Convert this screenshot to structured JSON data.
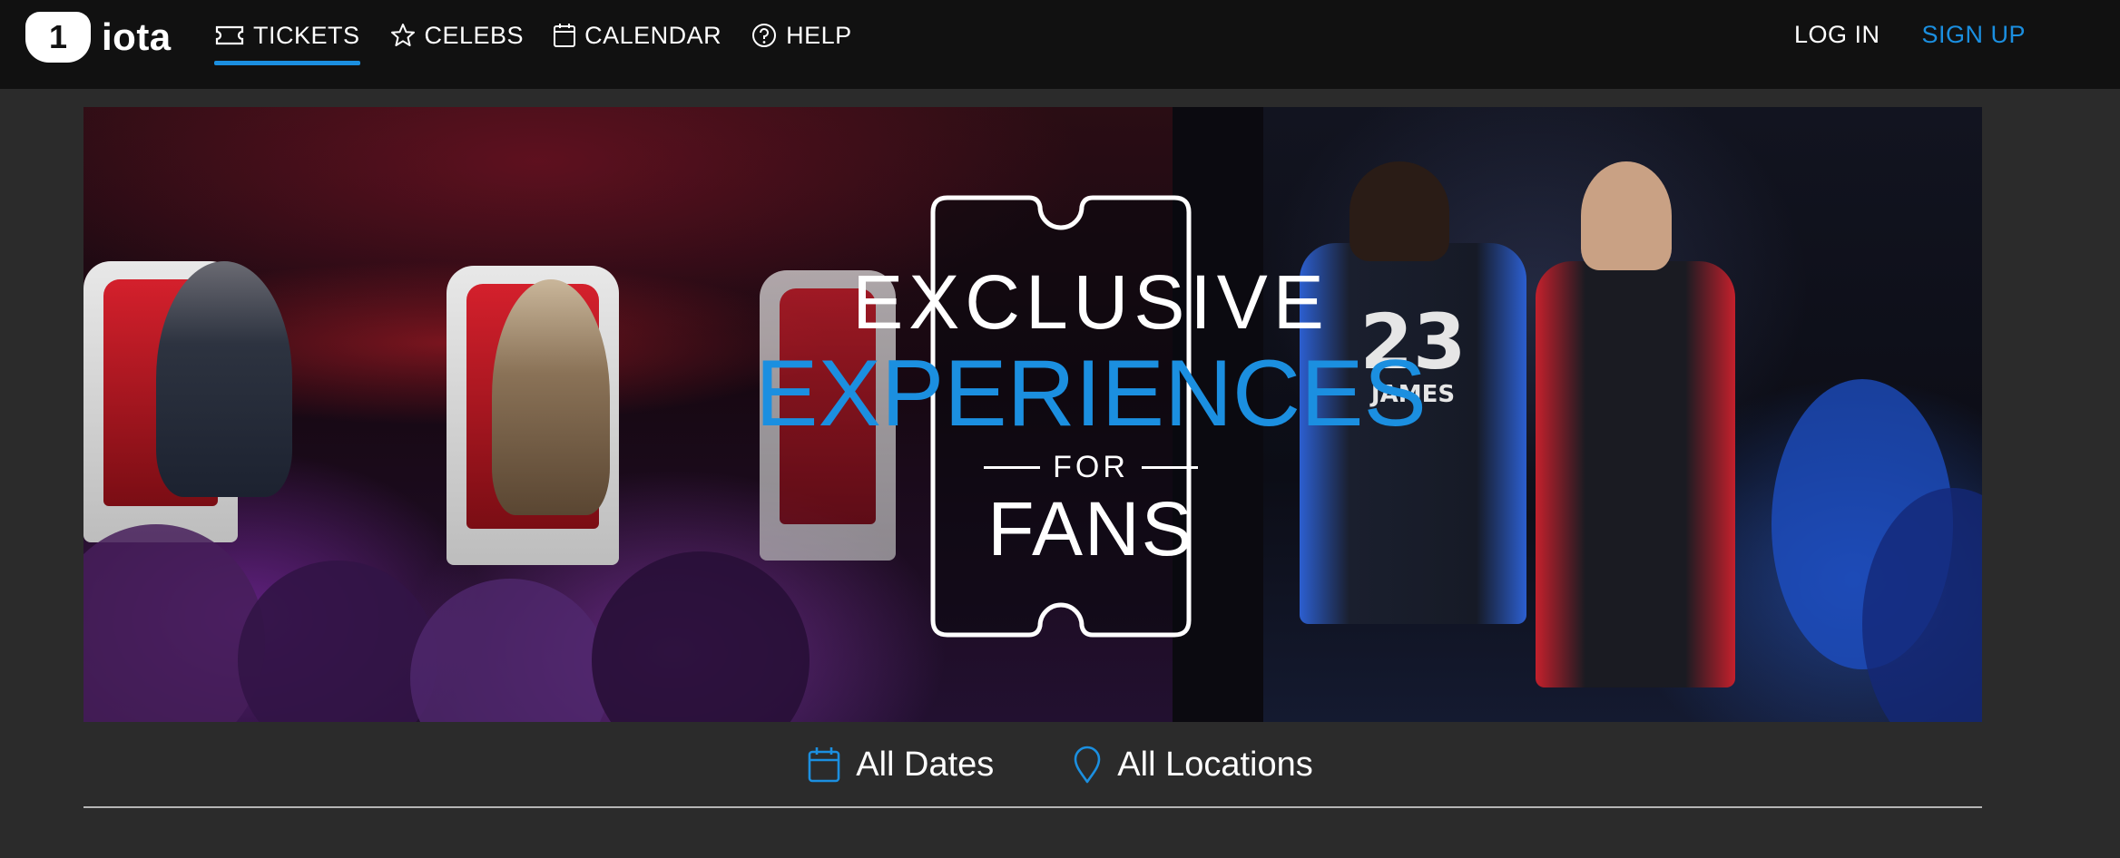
{
  "brand": {
    "mark": "1",
    "name": "iota"
  },
  "nav": {
    "items": [
      {
        "label": "TICKETS",
        "icon": "ticket-icon",
        "active": true
      },
      {
        "label": "CELEBS",
        "icon": "star-icon",
        "active": false
      },
      {
        "label": "CALENDAR",
        "icon": "calendar-icon",
        "active": false
      },
      {
        "label": "HELP",
        "icon": "help-icon",
        "active": false
      }
    ]
  },
  "auth": {
    "login": "LOG IN",
    "signup": "SIGN UP"
  },
  "hero": {
    "line1": "EXCLUSIVE",
    "line2": "EXPERIENCES",
    "line3": "FOR",
    "line4": "FANS",
    "jersey_number": "23",
    "jersey_name": "JAMES"
  },
  "filters": {
    "dates": {
      "label": "All Dates",
      "icon": "calendar-icon"
    },
    "locations": {
      "label": "All Locations",
      "icon": "location-pin-icon"
    }
  },
  "colors": {
    "accent": "#1b8fe0",
    "topbar": "#111111",
    "page_bg": "#2b2b2b"
  }
}
